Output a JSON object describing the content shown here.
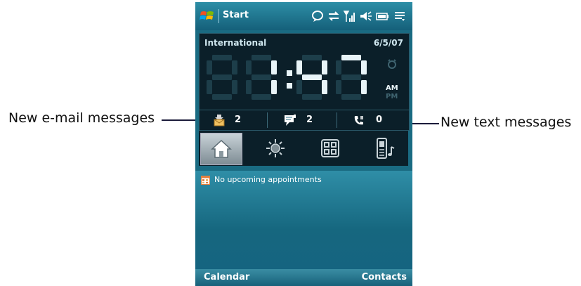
{
  "callouts": {
    "left_label": "New e-mail messages",
    "right_label": "New text messages"
  },
  "status_bar": {
    "start_label": "Start",
    "icons": [
      "windows-logo",
      "chat-bubble-icon",
      "sync-arrows-icon",
      "signal-strength-icon",
      "speaker-icon",
      "battery-icon",
      "menu-icon"
    ]
  },
  "clock": {
    "location": "International",
    "date": "6/5/07",
    "time": "1:47",
    "am_label": "AM",
    "pm_label": "PM",
    "active_period": "AM"
  },
  "notifications": {
    "email_count": "2",
    "text_count": "2",
    "missed_calls_count": "0"
  },
  "tabs": [
    {
      "name": "home",
      "active": true
    },
    {
      "name": "weather",
      "active": false
    },
    {
      "name": "launcher",
      "active": false
    },
    {
      "name": "sound",
      "active": false
    }
  ],
  "agenda": {
    "text": "No upcoming appointments"
  },
  "softkeys": {
    "left": "Calendar",
    "right": "Contacts"
  },
  "colors": {
    "background": "#1a6b82",
    "clock_panel": "#0b1f29",
    "digit_on": "#e8f4f8",
    "digit_off": "#1d3e4a"
  }
}
